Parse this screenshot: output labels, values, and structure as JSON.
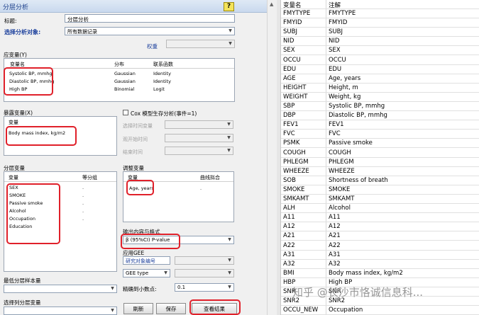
{
  "dialog": {
    "title": "分层分析",
    "help_label": "?",
    "title_label": "标题:",
    "title_value": "分层分析",
    "target_label": "选择分析对象:",
    "target_value": "所有数据记录",
    "weight_label": "权重",
    "outcome": {
      "label": "应变量(Y)",
      "headers": [
        "变量名",
        "分布",
        "联系函数"
      ],
      "rows": [
        [
          "Systolic BP, mmhg",
          "Gaussian",
          "Identity"
        ],
        [
          "Diastolic BP, mmhg",
          "Gaussian",
          "Identity"
        ],
        [
          "High BP",
          "Binomial",
          "Logit"
        ]
      ]
    },
    "exposure": {
      "label": "暴露变量(X)",
      "header": "变量",
      "value": "Body mass index, kg/m2"
    },
    "cox": {
      "label": "Cox 模型生存分析(事件=1)",
      "time_label": "选择时间变量",
      "start_label": "观开始时间",
      "end_label": "结束时间"
    },
    "strata": {
      "label": "分层变量",
      "headers": [
        "变量",
        "等分组"
      ],
      "rows": [
        "SEX",
        "SMOKE",
        "Passive smoke",
        "Alcohol",
        "Occupation",
        "Education"
      ],
      "dot": "."
    },
    "adjust": {
      "label": "调整变量",
      "headers": [
        "变量",
        "曲线拟合"
      ],
      "rows": [
        "Age, years"
      ],
      "dot": "."
    },
    "output": {
      "label": "输出内容与格式",
      "value": "β (95%CI) P-value",
      "gee_label": "应用GEE",
      "subject_id_label": "研究对象编号",
      "gee_type": "GEE type",
      "decimal_label": "精确到小数点:",
      "decimal_value": "0.1"
    },
    "min_stratum_label": "最低分层样本量",
    "select_stratum_label": "选择列分层变量",
    "buttons": {
      "refresh": "刷新",
      "save": "保存",
      "view": "查看结果"
    }
  },
  "variable_table": {
    "headers": [
      "变量名",
      "注解"
    ],
    "rows": [
      [
        "FMYTYPE",
        "FMYTYPE"
      ],
      [
        "FMYID",
        "FMYID"
      ],
      [
        "SUBJ",
        "SUBJ"
      ],
      [
        "NID",
        "NID"
      ],
      [
        "SEX",
        "SEX"
      ],
      [
        "OCCU",
        "OCCU"
      ],
      [
        "EDU",
        "EDU"
      ],
      [
        "AGE",
        "Age, years"
      ],
      [
        "HEIGHT",
        "Height, m"
      ],
      [
        "WEIGHT",
        "Weight, kg"
      ],
      [
        "SBP",
        "Systolic BP, mmhg"
      ],
      [
        "DBP",
        "Diastolic BP, mmhg"
      ],
      [
        "FEV1",
        "FEV1"
      ],
      [
        "FVC",
        "FVC"
      ],
      [
        "PSMK",
        "Passive smoke"
      ],
      [
        "COUGH",
        "COUGH"
      ],
      [
        "PHLEGM",
        "PHLEGM"
      ],
      [
        "WHEEZE",
        "WHEEZE"
      ],
      [
        "SOB",
        "Shortness of breath"
      ],
      [
        "SMOKE",
        "SMOKE"
      ],
      [
        "SMKAMT",
        "SMKAMT"
      ],
      [
        "ALH",
        "Alcohol"
      ],
      [
        "A11",
        "A11"
      ],
      [
        "A12",
        "A12"
      ],
      [
        "A21",
        "A21"
      ],
      [
        "A22",
        "A22"
      ],
      [
        "A31",
        "A31"
      ],
      [
        "A32",
        "A32"
      ],
      [
        "BMI",
        "Body mass index, kg/m2"
      ],
      [
        "HBP",
        "High BP"
      ],
      [
        "SNR",
        "SNR"
      ],
      [
        "SNR2",
        "SNR2"
      ],
      [
        "OCCU_NEW",
        "Occupation"
      ]
    ]
  },
  "watermark": "知乎 @长沙市恪诚信息科..."
}
